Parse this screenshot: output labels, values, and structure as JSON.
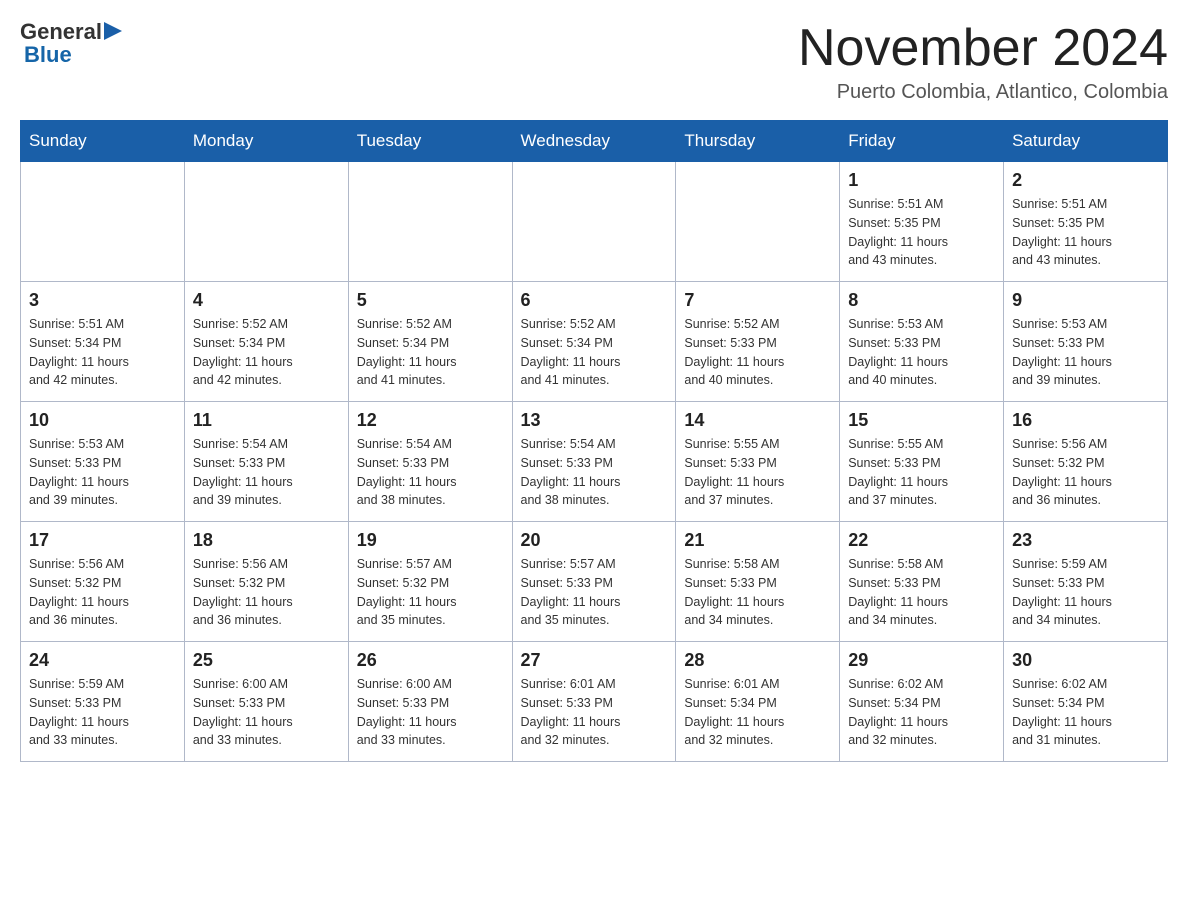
{
  "logo": {
    "general": "General",
    "arrow": "▶",
    "blue": "Blue"
  },
  "title": "November 2024",
  "location": "Puerto Colombia, Atlantico, Colombia",
  "weekdays": [
    "Sunday",
    "Monday",
    "Tuesday",
    "Wednesday",
    "Thursday",
    "Friday",
    "Saturday"
  ],
  "weeks": [
    [
      {
        "day": "",
        "info": ""
      },
      {
        "day": "",
        "info": ""
      },
      {
        "day": "",
        "info": ""
      },
      {
        "day": "",
        "info": ""
      },
      {
        "day": "",
        "info": ""
      },
      {
        "day": "1",
        "info": "Sunrise: 5:51 AM\nSunset: 5:35 PM\nDaylight: 11 hours\nand 43 minutes."
      },
      {
        "day": "2",
        "info": "Sunrise: 5:51 AM\nSunset: 5:35 PM\nDaylight: 11 hours\nand 43 minutes."
      }
    ],
    [
      {
        "day": "3",
        "info": "Sunrise: 5:51 AM\nSunset: 5:34 PM\nDaylight: 11 hours\nand 42 minutes."
      },
      {
        "day": "4",
        "info": "Sunrise: 5:52 AM\nSunset: 5:34 PM\nDaylight: 11 hours\nand 42 minutes."
      },
      {
        "day": "5",
        "info": "Sunrise: 5:52 AM\nSunset: 5:34 PM\nDaylight: 11 hours\nand 41 minutes."
      },
      {
        "day": "6",
        "info": "Sunrise: 5:52 AM\nSunset: 5:34 PM\nDaylight: 11 hours\nand 41 minutes."
      },
      {
        "day": "7",
        "info": "Sunrise: 5:52 AM\nSunset: 5:33 PM\nDaylight: 11 hours\nand 40 minutes."
      },
      {
        "day": "8",
        "info": "Sunrise: 5:53 AM\nSunset: 5:33 PM\nDaylight: 11 hours\nand 40 minutes."
      },
      {
        "day": "9",
        "info": "Sunrise: 5:53 AM\nSunset: 5:33 PM\nDaylight: 11 hours\nand 39 minutes."
      }
    ],
    [
      {
        "day": "10",
        "info": "Sunrise: 5:53 AM\nSunset: 5:33 PM\nDaylight: 11 hours\nand 39 minutes."
      },
      {
        "day": "11",
        "info": "Sunrise: 5:54 AM\nSunset: 5:33 PM\nDaylight: 11 hours\nand 39 minutes."
      },
      {
        "day": "12",
        "info": "Sunrise: 5:54 AM\nSunset: 5:33 PM\nDaylight: 11 hours\nand 38 minutes."
      },
      {
        "day": "13",
        "info": "Sunrise: 5:54 AM\nSunset: 5:33 PM\nDaylight: 11 hours\nand 38 minutes."
      },
      {
        "day": "14",
        "info": "Sunrise: 5:55 AM\nSunset: 5:33 PM\nDaylight: 11 hours\nand 37 minutes."
      },
      {
        "day": "15",
        "info": "Sunrise: 5:55 AM\nSunset: 5:33 PM\nDaylight: 11 hours\nand 37 minutes."
      },
      {
        "day": "16",
        "info": "Sunrise: 5:56 AM\nSunset: 5:32 PM\nDaylight: 11 hours\nand 36 minutes."
      }
    ],
    [
      {
        "day": "17",
        "info": "Sunrise: 5:56 AM\nSunset: 5:32 PM\nDaylight: 11 hours\nand 36 minutes."
      },
      {
        "day": "18",
        "info": "Sunrise: 5:56 AM\nSunset: 5:32 PM\nDaylight: 11 hours\nand 36 minutes."
      },
      {
        "day": "19",
        "info": "Sunrise: 5:57 AM\nSunset: 5:32 PM\nDaylight: 11 hours\nand 35 minutes."
      },
      {
        "day": "20",
        "info": "Sunrise: 5:57 AM\nSunset: 5:33 PM\nDaylight: 11 hours\nand 35 minutes."
      },
      {
        "day": "21",
        "info": "Sunrise: 5:58 AM\nSunset: 5:33 PM\nDaylight: 11 hours\nand 34 minutes."
      },
      {
        "day": "22",
        "info": "Sunrise: 5:58 AM\nSunset: 5:33 PM\nDaylight: 11 hours\nand 34 minutes."
      },
      {
        "day": "23",
        "info": "Sunrise: 5:59 AM\nSunset: 5:33 PM\nDaylight: 11 hours\nand 34 minutes."
      }
    ],
    [
      {
        "day": "24",
        "info": "Sunrise: 5:59 AM\nSunset: 5:33 PM\nDaylight: 11 hours\nand 33 minutes."
      },
      {
        "day": "25",
        "info": "Sunrise: 6:00 AM\nSunset: 5:33 PM\nDaylight: 11 hours\nand 33 minutes."
      },
      {
        "day": "26",
        "info": "Sunrise: 6:00 AM\nSunset: 5:33 PM\nDaylight: 11 hours\nand 33 minutes."
      },
      {
        "day": "27",
        "info": "Sunrise: 6:01 AM\nSunset: 5:33 PM\nDaylight: 11 hours\nand 32 minutes."
      },
      {
        "day": "28",
        "info": "Sunrise: 6:01 AM\nSunset: 5:34 PM\nDaylight: 11 hours\nand 32 minutes."
      },
      {
        "day": "29",
        "info": "Sunrise: 6:02 AM\nSunset: 5:34 PM\nDaylight: 11 hours\nand 32 minutes."
      },
      {
        "day": "30",
        "info": "Sunrise: 6:02 AM\nSunset: 5:34 PM\nDaylight: 11 hours\nand 31 minutes."
      }
    ]
  ]
}
